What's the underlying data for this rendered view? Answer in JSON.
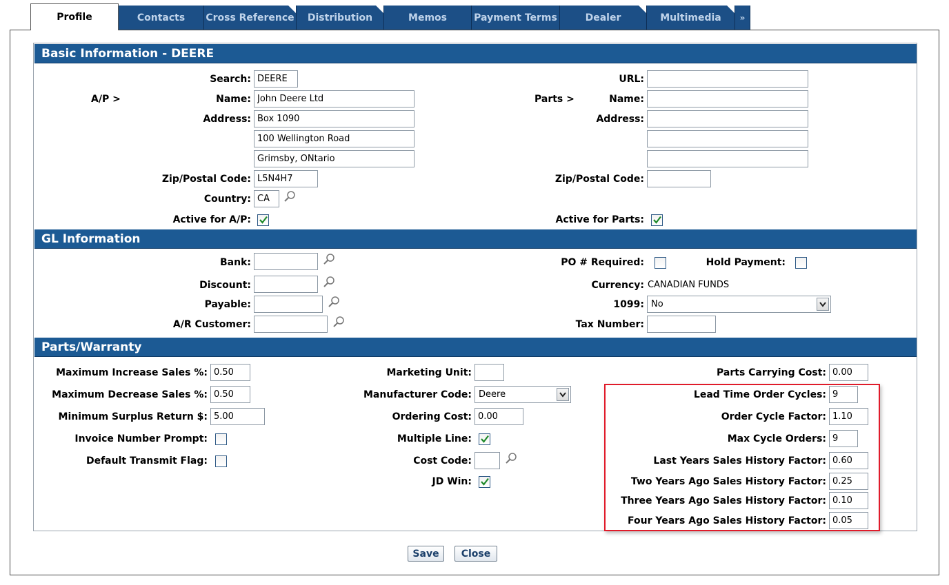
{
  "tabs": [
    "Profile",
    "Contacts",
    "Cross Reference",
    "Distribution",
    "Memos",
    "Payment Terms",
    "Dealer",
    "Multimedia"
  ],
  "tabs_more": "»",
  "basic": {
    "title": "Basic Information -  DEERE",
    "ap_label": "A/P >",
    "parts_label": "Parts >",
    "search_label": "Search:",
    "search_value": "DEERE",
    "name_label": "Name:",
    "name_value": "John Deere Ltd",
    "address_label": "Address:",
    "address1": "Box 1090",
    "address2": "100 Wellington Road",
    "address3": "Grimsby, ONtario",
    "zip_label": "Zip/Postal Code:",
    "zip_value": "L5N4H7",
    "country_label": "Country:",
    "country_value": "CA",
    "active_ap_label": "Active for A/P:",
    "url_label": "URL:",
    "url_value": "",
    "parts_name_label": "Name:",
    "parts_name_value": "",
    "parts_address_label": "Address:",
    "parts_address1": "",
    "parts_address2": "",
    "parts_address3": "",
    "parts_zip_label": "Zip/Postal Code:",
    "parts_zip_value": "",
    "active_parts_label": "Active for Parts:"
  },
  "gl": {
    "title": "GL Information",
    "bank_label": "Bank:",
    "bank_value": "",
    "discount_label": "Discount:",
    "discount_value": "",
    "payable_label": "Payable:",
    "payable_value": "",
    "ar_label": "A/R Customer:",
    "ar_value": "",
    "po_label": "PO # Required:",
    "hold_label": "Hold Payment:",
    "currency_label": "Currency:",
    "currency_value": "CANADIAN FUNDS",
    "form1099_label": "1099:",
    "form1099_value": "No",
    "tax_label": "Tax Number:",
    "tax_value": ""
  },
  "parts": {
    "title": "Parts/Warranty",
    "max_inc_label": "Maximum Increase Sales %:",
    "max_inc_value": "0.50",
    "max_dec_label": "Maximum Decrease Sales %:",
    "max_dec_value": "0.50",
    "min_surplus_label": "Minimum Surplus Return $:",
    "min_surplus_value": "5.00",
    "invoice_prompt_label": "Invoice Number Prompt:",
    "transmit_flag_label": "Default Transmit Flag:",
    "marketing_unit_label": "Marketing Unit:",
    "marketing_unit_value": "",
    "mfr_code_label": "Manufacturer Code:",
    "mfr_code_value": "Deere",
    "ordering_cost_label": "Ordering Cost:",
    "ordering_cost_value": "0.00",
    "multiple_line_label": "Multiple Line:",
    "cost_code_label": "Cost Code:",
    "cost_code_value": "",
    "jd_win_label": "JD Win:",
    "carrying_cost_label": "Parts Carrying Cost:",
    "carrying_cost_value": "0.00",
    "lead_time_label": "Lead Time Order Cycles:",
    "lead_time_value": "9",
    "order_cycle_label": "Order Cycle Factor:",
    "order_cycle_value": "1.10",
    "max_cycle_label": "Max Cycle Orders:",
    "max_cycle_value": "9",
    "last_year_label": "Last Years Sales History Factor:",
    "last_year_value": "0.60",
    "two_years_label": "Two Years Ago Sales History Factor:",
    "two_years_value": "0.25",
    "three_years_label": "Three Years Ago Sales History Factor:",
    "three_years_value": "0.10",
    "four_years_label": "Four Years Ago Sales History Factor:",
    "four_years_value": "0.05"
  },
  "checkboxes": {
    "active_ap": true,
    "active_parts": true,
    "po_required": false,
    "hold_payment": false,
    "invoice_prompt": false,
    "transmit_flag": false,
    "multiple_line": true,
    "jd_win": true
  },
  "buttons": {
    "save": "Save",
    "close": "Close"
  },
  "colors": {
    "tab_bg": "#1c4f86",
    "section_bar": "#1c5a94",
    "highlight_border": "#e01b2a",
    "check": "#1f8a2b"
  }
}
